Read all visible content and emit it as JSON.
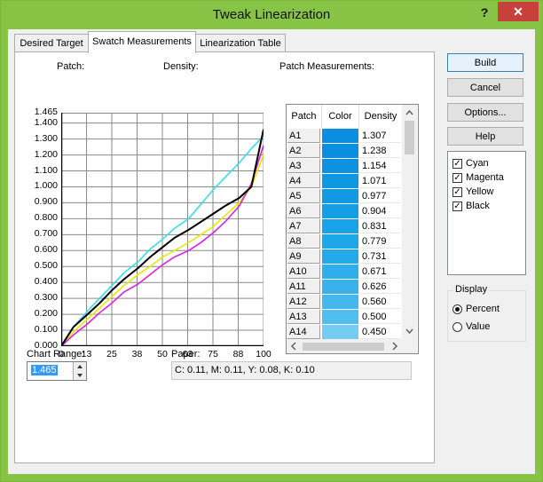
{
  "window": {
    "title": "Tweak Linearization",
    "help_label": "?",
    "close_label": "✕"
  },
  "tabs": [
    {
      "label": "Desired Target"
    },
    {
      "label": "Swatch Measurements",
      "active": true
    },
    {
      "label": "Linearization Table"
    }
  ],
  "chart": {
    "patch_label": "Patch:",
    "density_label": "Density:"
  },
  "chart_data": {
    "type": "line",
    "title": "",
    "xlabel": "",
    "ylabel": "",
    "x_ticks": [
      "0",
      "13",
      "25",
      "38",
      "50",
      "63",
      "75",
      "88",
      "100"
    ],
    "y_ticks": [
      "0.000",
      "0.100",
      "0.200",
      "0.300",
      "0.400",
      "0.500",
      "0.600",
      "0.700",
      "0.800",
      "0.900",
      "1.000",
      "1.100",
      "1.200",
      "1.300",
      "1.400",
      "1.465"
    ],
    "xlim": [
      0,
      100
    ],
    "ylim": [
      0,
      1.465
    ],
    "grid": true,
    "x": [
      0,
      6,
      13,
      19,
      25,
      31,
      38,
      44,
      50,
      56,
      63,
      69,
      75,
      81,
      88,
      94,
      100
    ],
    "series": [
      {
        "color": "#33e0e8",
        "values": [
          0.0,
          0.12,
          0.22,
          0.3,
          0.38,
          0.46,
          0.53,
          0.61,
          0.67,
          0.74,
          0.8,
          0.89,
          0.98,
          1.06,
          1.15,
          1.24,
          1.32
        ]
      },
      {
        "color": "#e8e800",
        "values": [
          0.0,
          0.09,
          0.17,
          0.24,
          0.31,
          0.38,
          0.45,
          0.5,
          0.56,
          0.6,
          0.65,
          0.7,
          0.75,
          0.82,
          0.9,
          1.0,
          1.2
        ]
      },
      {
        "color": "#e020e0",
        "values": [
          0.0,
          0.07,
          0.14,
          0.21,
          0.27,
          0.34,
          0.39,
          0.45,
          0.51,
          0.56,
          0.6,
          0.65,
          0.71,
          0.78,
          0.88,
          1.02,
          1.26
        ]
      },
      {
        "color": "#000000",
        "values": [
          0.0,
          0.12,
          0.2,
          0.27,
          0.35,
          0.42,
          0.49,
          0.56,
          0.62,
          0.68,
          0.73,
          0.78,
          0.83,
          0.88,
          0.93,
          1.0,
          1.36
        ]
      }
    ]
  },
  "patch_table": {
    "title": "Patch Measurements:",
    "columns": [
      "Patch",
      "Color",
      "Density"
    ],
    "rows": [
      {
        "patch": "A1",
        "color": "#0c8ee0",
        "density": "1.307"
      },
      {
        "patch": "A2",
        "color": "#0c8ee0",
        "density": "1.238"
      },
      {
        "patch": "A3",
        "color": "#0d91e1",
        "density": "1.154"
      },
      {
        "patch": "A4",
        "color": "#1097e3",
        "density": "1.071"
      },
      {
        "patch": "A5",
        "color": "#119ae4",
        "density": "0.977"
      },
      {
        "patch": "A6",
        "color": "#159ee6",
        "density": "0.904"
      },
      {
        "patch": "A7",
        "color": "#19a2e7",
        "density": "0.831"
      },
      {
        "patch": "A8",
        "color": "#1da6e8",
        "density": "0.779"
      },
      {
        "patch": "A9",
        "color": "#22aae9",
        "density": "0.731"
      },
      {
        "patch": "A10",
        "color": "#2eafea",
        "density": "0.671"
      },
      {
        "patch": "A11",
        "color": "#38b2eb",
        "density": "0.626"
      },
      {
        "patch": "A12",
        "color": "#44b8ed",
        "density": "0.560"
      },
      {
        "patch": "A13",
        "color": "#52bdef",
        "density": "0.500"
      },
      {
        "patch": "A14",
        "color": "#74ccf2",
        "density": "0.450"
      }
    ]
  },
  "chart_range": {
    "label": "Chart Range:",
    "value": "1.465"
  },
  "paper": {
    "label": "Paper:",
    "value": "C: 0.11, M: 0.11, Y: 0.08, K: 0.10"
  },
  "buttons": {
    "build": "Build",
    "cancel": "Cancel",
    "options": "Options...",
    "help": "Help"
  },
  "channels": [
    {
      "label": "Cyan",
      "checked": true
    },
    {
      "label": "Magenta",
      "checked": true
    },
    {
      "label": "Yellow",
      "checked": true
    },
    {
      "label": "Black",
      "checked": true
    }
  ],
  "display": {
    "label": "Display",
    "options": [
      {
        "label": "Percent",
        "selected": true
      },
      {
        "label": "Value",
        "selected": false
      }
    ]
  }
}
